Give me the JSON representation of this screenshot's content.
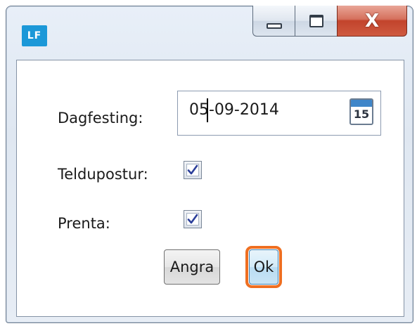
{
  "app": {
    "icon_text": "LF"
  },
  "window_controls": {
    "close_glyph": "X"
  },
  "form": {
    "date_label": "Dagfesting:",
    "date_value": "05-09-2014",
    "calendar_day": "15",
    "email_label": "Teldupostur:",
    "email_checked": true,
    "print_label": "Prenta:",
    "print_checked": true
  },
  "buttons": {
    "cancel_label": "Angra",
    "ok_label": "Ok"
  },
  "colors": {
    "app_icon": "#1c98d8",
    "focus_outline": "#ef6f21",
    "check": "#2b3f9a"
  }
}
